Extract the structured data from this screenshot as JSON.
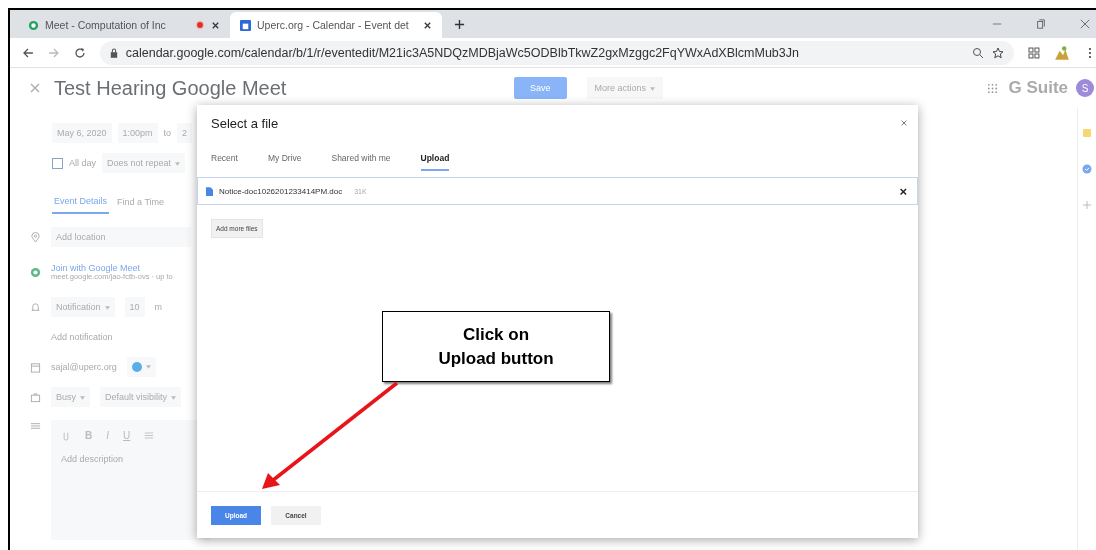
{
  "browser": {
    "tabs": [
      {
        "title": "Meet - Computation of Inc",
        "selected": false,
        "recording": true
      },
      {
        "title": "Uperc.org - Calendar - Event det",
        "selected": true,
        "recording": false
      }
    ],
    "url": "calendar.google.com/calendar/b/1/r/eventedit/M21ic3A5NDQzMDBjaWc5ODBlbTkwZ2gxMzggc2FqYWxAdXBlcmMub3Jn"
  },
  "event": {
    "title": "Test Hearing Google Meet",
    "date": "May 6, 2020",
    "start": "1:00pm",
    "to": "to",
    "end": "2",
    "all_day": {
      "label": "All day",
      "checked": false
    },
    "repeat": "Does not repeat",
    "tabs": [
      {
        "label": "Event Details",
        "selected": true
      },
      {
        "label": "Find a Time",
        "selected": false
      }
    ],
    "location_placeholder": "Add location",
    "meet_link": "Join with Google Meet",
    "meet_detail": "meet.google.com/jao-fctb-ovs · up to",
    "notification": "Notification",
    "notification_value": "10",
    "notification_unit": "m",
    "add_notification": "Add notification",
    "calendar": {
      "name": "sajal@uperc.org",
      "color": "#5aaee8"
    },
    "availability": "Busy",
    "visibility": "Default visibility",
    "format": [
      "B",
      "I",
      "U"
    ],
    "description_placeholder": "Add description"
  },
  "header": {
    "save": "Save",
    "more": "More actions",
    "brand": "G Suite",
    "avatar": "S"
  },
  "dialog": {
    "title": "Select a file",
    "tabs": [
      {
        "label": "Recent",
        "selected": false
      },
      {
        "label": "My Drive",
        "selected": false
      },
      {
        "label": "Shared with me",
        "selected": false
      },
      {
        "label": "Upload",
        "selected": true
      }
    ],
    "file": {
      "name": "Notice-doc1026201233414PM.doc",
      "size": "31K"
    },
    "remove": "×",
    "add_more": "Add more files",
    "upload": "Upload",
    "cancel": "Cancel"
  },
  "callout": "Click on Upload button"
}
